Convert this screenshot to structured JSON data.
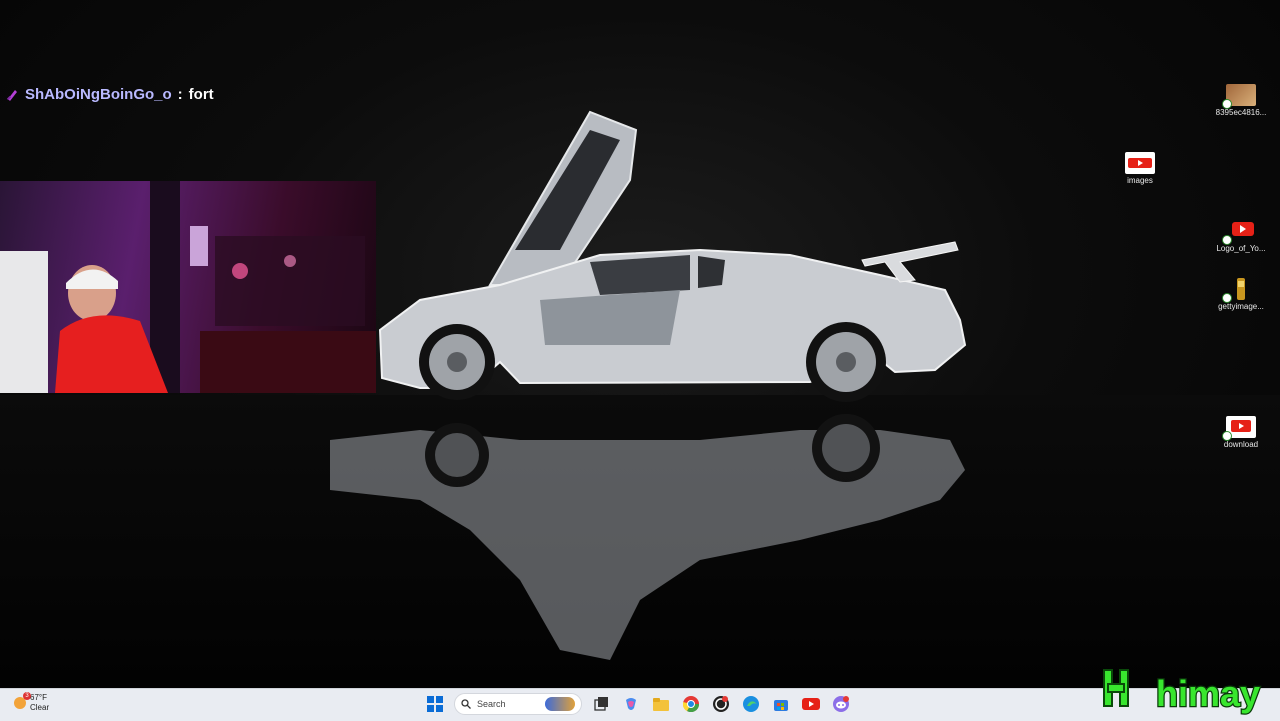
{
  "chat": {
    "username": "ShAbOiNgBoinGo_o",
    "separator": ":",
    "message": "fort",
    "badge_icon": "purple-sword-icon"
  },
  "desktop_icons": [
    {
      "label": "8395ec4816...",
      "icon": "image-thumbnail-icon"
    },
    {
      "label": "images",
      "icon": "youtube-image-icon"
    },
    {
      "label": "Logo_of_Yo...",
      "icon": "youtube-logo-icon"
    },
    {
      "label": "gettyimage...",
      "icon": "image-thumbnail-icon"
    },
    {
      "label": "download",
      "icon": "youtube-image-icon"
    }
  ],
  "taskbar": {
    "weather_temp": "67°F",
    "weather_desc": "Clear",
    "weather_alert_count": "3",
    "search_placeholder": "Search",
    "apps": [
      "start-icon",
      "search-icon",
      "widgets-icon",
      "task-view-icon",
      "copilot-icon",
      "file-explorer-icon",
      "chrome-icon",
      "obs-icon",
      "edge-icon",
      "store-icon",
      "youtube-icon",
      "discord-icon"
    ]
  },
  "overlay": {
    "brand": "himay"
  },
  "colors": {
    "taskbar_bg": "#e9ecf2",
    "chat_user": "#b9b9ff",
    "brand_green": "#38e62e"
  }
}
